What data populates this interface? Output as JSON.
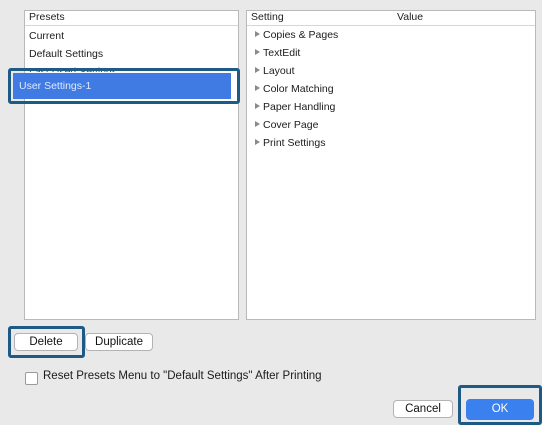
{
  "presets": {
    "header": "Presets",
    "items": [
      "Current",
      "Default Settings",
      "Last Used Settings"
    ],
    "selected": "User Settings-1"
  },
  "settings": {
    "header_setting": "Setting",
    "header_value": "Value",
    "items": [
      "Copies & Pages",
      "TextEdit",
      "Layout",
      "Color Matching",
      "Paper Handling",
      "Cover Page",
      "Print Settings"
    ]
  },
  "buttons": {
    "delete": "Delete",
    "duplicate": "Duplicate",
    "cancel": "Cancel",
    "ok": "OK"
  },
  "reset_checkbox": {
    "label": "Reset Presets Menu to \"Default Settings\" After Printing",
    "checked": false
  },
  "colors": {
    "selection": "#3f7be3",
    "accent": "#3a80ef",
    "callout": "#1e5a86"
  }
}
